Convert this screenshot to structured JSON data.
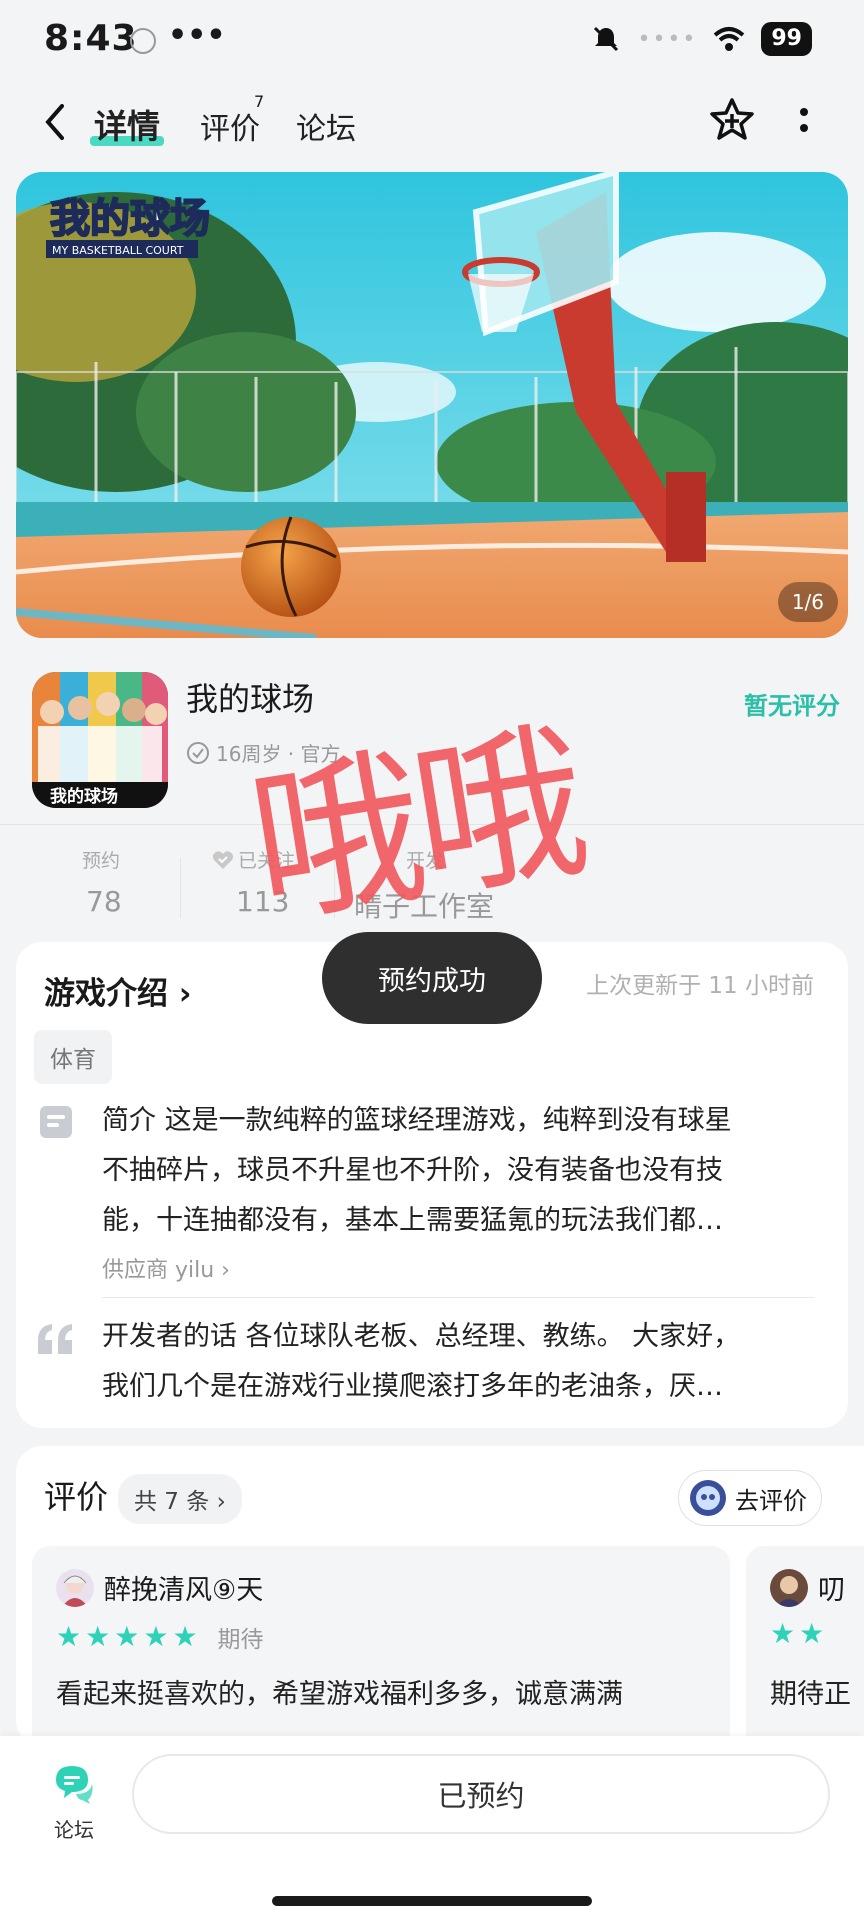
{
  "status_bar": {
    "time": "8:43",
    "dots": "•••",
    "battery": "99"
  },
  "nav": {
    "tabs": [
      {
        "label": "详情",
        "active": true
      },
      {
        "label": "评价",
        "badge": "7"
      },
      {
        "label": "论坛"
      }
    ]
  },
  "banner": {
    "logo_cn": "我的球场",
    "logo_en": "MY BASKETBALL COURT",
    "page_indicator": "1/6"
  },
  "game": {
    "name": "我的球场",
    "meta": "16周岁 · 官方",
    "rating": "暂无评分",
    "icon_text": "我的球场"
  },
  "stats": [
    {
      "label": "预约",
      "value": "78"
    },
    {
      "label": "已关注",
      "value": "113"
    },
    {
      "label": "开发",
      "value": "晴子工作室"
    }
  ],
  "overlay": "哦哦",
  "toast": "预约成功",
  "intro": {
    "title": "游戏介绍",
    "updated": "上次更新于 11 小时前",
    "tag": "体育",
    "summary_lines": [
      "简介 这是一款纯粹的篮球经理游戏，纯粹到没有球星",
      "不抽碎片，球员不升星也不升阶，没有装备也没有技",
      "能，十连抽都没有，基本上需要猛氪的玩法我们都…"
    ],
    "supplier": "供应商 yilu",
    "dev_words_lines": [
      "开发者的话 各位球队老板、总经理、教练。 大家好，",
      "我们几个是在游戏行业摸爬滚打多年的老油条，厌…"
    ]
  },
  "reviews": {
    "title": "评价",
    "count": "共 7 条",
    "go_review": "去评价",
    "items": [
      {
        "user": "醉挽清风⑨天",
        "stars": 5,
        "label": "期待",
        "text": "看起来挺喜欢的，希望游戏福利多多，诚意满满"
      },
      {
        "user": "叨",
        "stars": 2,
        "label": "",
        "text": "期待正"
      }
    ]
  },
  "bottom": {
    "forum_label": "论坛",
    "reserved_label": "已预约"
  },
  "colors": {
    "accent": "#2ed3b7",
    "rating": "#2bbfa7",
    "overlay": "#f05a5f"
  }
}
